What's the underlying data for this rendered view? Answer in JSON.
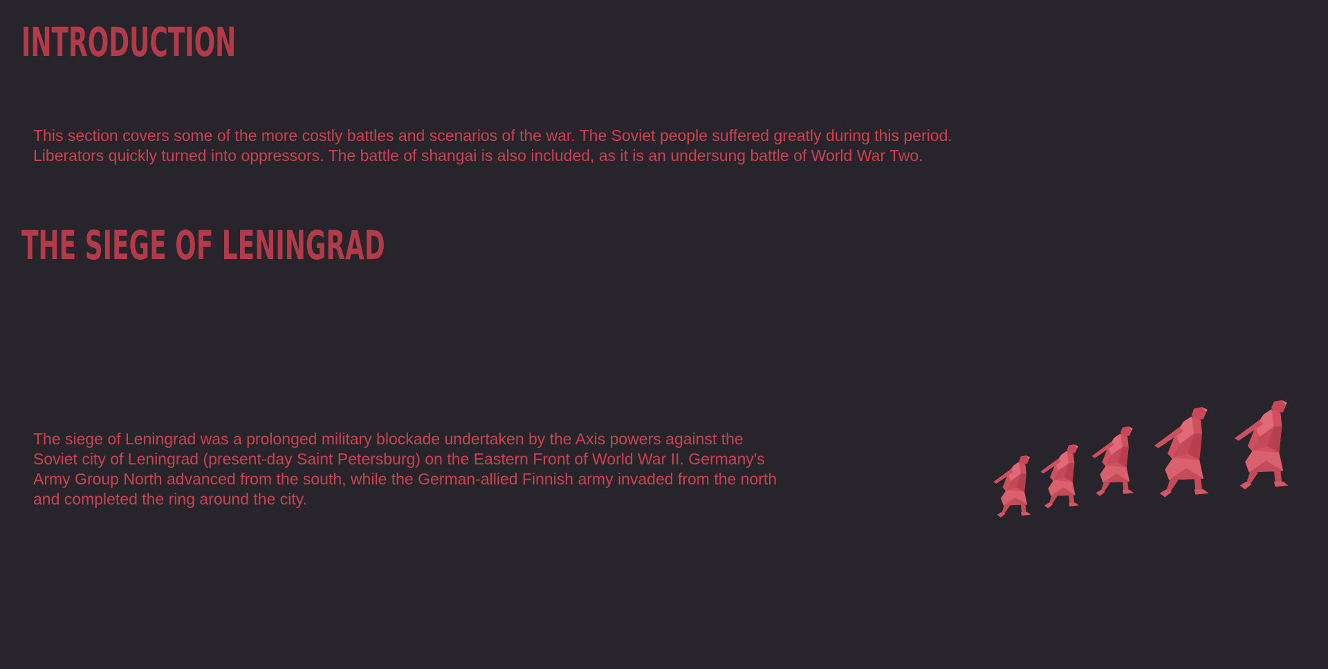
{
  "sections": {
    "introduction": {
      "heading": "INTRODUCTION",
      "lines": [
        "This section covers some of the more costly battles and scenarios of the war. The Soviet people suffered greatly during this period.",
        "Liberators quickly turned into oppressors. The battle of shangai is also included, as it is an undersung battle of World War Two."
      ]
    },
    "siege": {
      "heading": "THE SIEGE OF LENINGRAD",
      "lines": [
        "The siege of Leningrad was a prolonged military blockade undertaken by the Axis powers against the",
        "Soviet city of Leningrad (present-day Saint Petersburg) on the Eastern Front of World War II. Germany's",
        "Army Group North advanced from the south, while the German-allied Finnish army invaded from the north",
        "and completed the ring around the city."
      ]
    }
  },
  "colors": {
    "background": "#27252b",
    "heading": "#b33a48",
    "text": "#c9424f",
    "figure": "#d0505e"
  },
  "illustration": {
    "icon": "marching-soldiers-icon",
    "figure_count": 5
  }
}
